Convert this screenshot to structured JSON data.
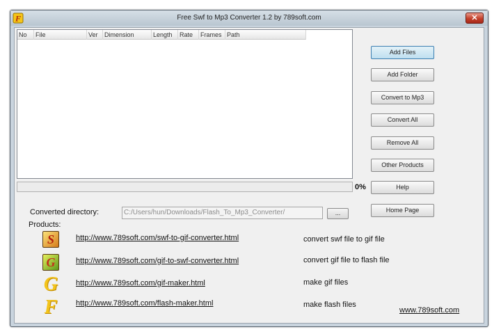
{
  "window": {
    "title": "Free Swf to Mp3 Converter 1.2 by 789soft.com",
    "close_glyph": "✕",
    "icon": "app-icon"
  },
  "file_list": {
    "columns": [
      "No",
      "File",
      "Ver",
      "Dimension",
      "Length",
      "Rate",
      "Frames",
      "Path"
    ],
    "rows": []
  },
  "progress": {
    "value": 0,
    "label": "0%"
  },
  "buttons": {
    "add_files": "Add Files",
    "add_folder": "Add Folder",
    "convert_to_mp3": "Convert to Mp3",
    "convert_all": "Convert All",
    "remove_all": "Remove All",
    "other_products": "Other Products",
    "help": "Help",
    "home_page": "Home Page"
  },
  "output": {
    "label": "Converted directory:",
    "value": "C:/Users/hun/Downloads/Flash_To_Mp3_Converter/",
    "browse_label": "..."
  },
  "products": {
    "label": "Products:",
    "items": [
      {
        "icon_letter": "S",
        "icon": "swf-to-gif-icon",
        "url": "http://www.789soft.com/swf-to-gif-converter.html",
        "description": "convert swf file to gif file"
      },
      {
        "icon_letter": "G",
        "icon": "gif-to-swf-icon",
        "url": "http://www.789soft.com/gif-to-swf-converter.html",
        "description": "convert gif file to flash file"
      },
      {
        "icon_letter": "G",
        "icon": "gif-maker-icon",
        "url": "http://www.789soft.com/gif-maker.html",
        "description": "make gif files"
      },
      {
        "icon_letter": "F",
        "icon": "flash-maker-icon",
        "url": "http://www.789soft.com/flash-maker.html",
        "description": "make flash files"
      }
    ]
  },
  "site_link": "www.789soft.com",
  "colors": {
    "frame": "#c9d4de",
    "client": "#f0f0f0",
    "close_button": "#c3402a",
    "default_button": "#bfdff0"
  }
}
